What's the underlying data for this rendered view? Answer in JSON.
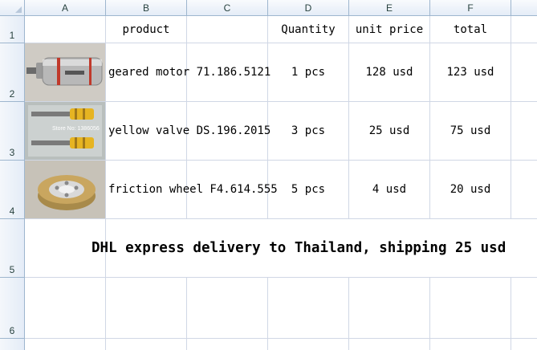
{
  "columns": [
    "A",
    "B",
    "C",
    "D",
    "E",
    "F"
  ],
  "rows": [
    "1",
    "2",
    "3",
    "4",
    "5",
    "6"
  ],
  "header": {
    "product": "product",
    "quantity": "Quantity",
    "unit_price": "unit price",
    "total": "total"
  },
  "items": [
    {
      "image": "geared-motor-photo",
      "product": "geared motor 71.186.5121",
      "quantity": "1 pcs",
      "unit_price": "128 usd",
      "total": "123 usd"
    },
    {
      "image": "yellow-valve-photo",
      "product": "yellow valve DS.196.2015",
      "quantity": "3 pcs",
      "unit_price": "25 usd",
      "total": "75 usd"
    },
    {
      "image": "friction-wheel-photo",
      "product": "friction wheel F4.614.555",
      "quantity": "5 pcs",
      "unit_price": "4 usd",
      "total": "20 usd"
    }
  ],
  "banner": "DHL express delivery to Thailand, shipping 25 usd",
  "valve_store_label": "Store No: 1386056",
  "colors": {
    "header_bg": "#e4ecf7",
    "header_border": "#9eb6ce",
    "gridline": "#d0d7e5",
    "motor_stripe": "#c0392b",
    "valve_yellow": "#e6b422",
    "wheel_tan": "#c9a65f"
  }
}
